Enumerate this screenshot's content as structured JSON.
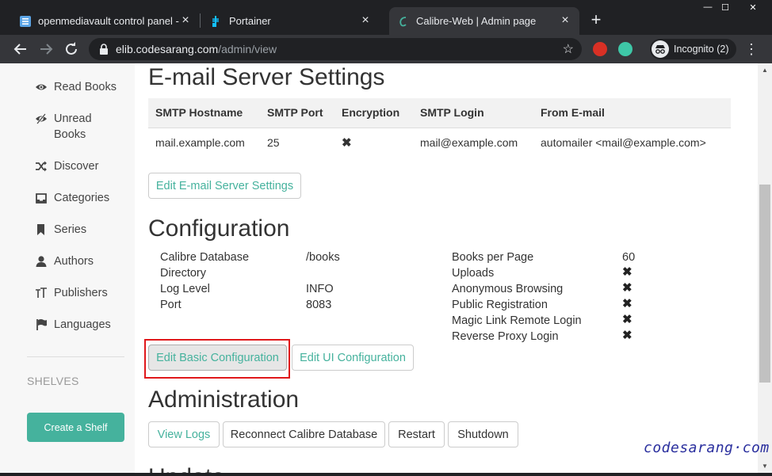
{
  "browser": {
    "tabs": [
      {
        "title": "openmediavault control panel - c",
        "active": false
      },
      {
        "title": "Portainer",
        "active": false
      },
      {
        "title": "Calibre-Web | Admin page",
        "active": true
      }
    ],
    "new_tab": "+",
    "window_controls": {
      "minimize": "—",
      "maximize": "☐",
      "close": "✕"
    },
    "url_host": "elib.codesarang.com",
    "url_path": "/admin/view",
    "incognito_label": "Incognito (2)",
    "menu": "⋮"
  },
  "sidebar": {
    "items": [
      {
        "label": "Read Books",
        "icon": "eye-icon"
      },
      {
        "label": "Unread Books",
        "icon": "eye-slash-icon"
      },
      {
        "label": "Discover",
        "icon": "random-icon"
      },
      {
        "label": "Categories",
        "icon": "inbox-icon"
      },
      {
        "label": "Series",
        "icon": "bookmark-icon"
      },
      {
        "label": "Authors",
        "icon": "user-icon"
      },
      {
        "label": "Publishers",
        "icon": "text-size-icon"
      },
      {
        "label": "Languages",
        "icon": "flag-icon"
      }
    ],
    "shelves_heading": "SHELVES",
    "create_shelf": "Create a Shelf"
  },
  "email": {
    "title": "E-mail Server Settings",
    "headers": [
      "SMTP Hostname",
      "SMTP Port",
      "Encryption",
      "SMTP Login",
      "From E-mail"
    ],
    "row": {
      "hostname": "mail.example.com",
      "port": "25",
      "encryption": "✖",
      "login": "mail@example.com",
      "from": "automailer <mail@example.com>"
    },
    "edit_button": "Edit E-mail Server Settings"
  },
  "config": {
    "title": "Configuration",
    "left": [
      {
        "label": "Calibre Database",
        "label2": "Directory",
        "value": "/books"
      },
      {
        "label": "Log Level",
        "value": "INFO"
      },
      {
        "label": "Port",
        "value": "8083"
      }
    ],
    "right": [
      {
        "label": "Books per Page",
        "value": "60"
      },
      {
        "label": "Uploads",
        "value": "✖"
      },
      {
        "label": "Anonymous Browsing",
        "value": "✖"
      },
      {
        "label": "Public Registration",
        "value": "✖"
      },
      {
        "label": "Magic Link Remote Login",
        "value": "✖"
      },
      {
        "label": "Reverse Proxy Login",
        "value": "✖"
      }
    ],
    "edit_basic": "Edit Basic Configuration",
    "edit_ui": "Edit UI Configuration"
  },
  "admin": {
    "title": "Administration",
    "buttons": [
      "View Logs",
      "Reconnect Calibre Database",
      "Restart",
      "Shutdown"
    ]
  },
  "update_heading_partial": "Update",
  "watermark": "codesarang·com",
  "colors": {
    "accent": "#45b29d",
    "highlight": "#e0181b",
    "chrome_dark": "#202124",
    "chrome_mid": "#35363a"
  }
}
